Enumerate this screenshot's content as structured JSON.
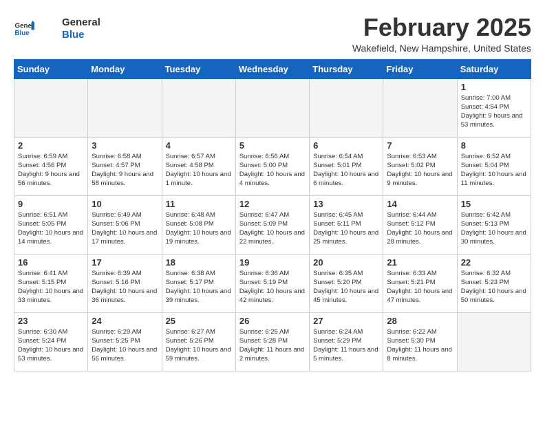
{
  "header": {
    "logo_line1": "General",
    "logo_line2": "Blue",
    "month_title": "February 2025",
    "location": "Wakefield, New Hampshire, United States"
  },
  "days_of_week": [
    "Sunday",
    "Monday",
    "Tuesday",
    "Wednesday",
    "Thursday",
    "Friday",
    "Saturday"
  ],
  "weeks": [
    [
      {
        "day": "",
        "info": ""
      },
      {
        "day": "",
        "info": ""
      },
      {
        "day": "",
        "info": ""
      },
      {
        "day": "",
        "info": ""
      },
      {
        "day": "",
        "info": ""
      },
      {
        "day": "",
        "info": ""
      },
      {
        "day": "1",
        "info": "Sunrise: 7:00 AM\nSunset: 4:54 PM\nDaylight: 9 hours\nand 53 minutes."
      }
    ],
    [
      {
        "day": "2",
        "info": "Sunrise: 6:59 AM\nSunset: 4:56 PM\nDaylight: 9 hours\nand 56 minutes."
      },
      {
        "day": "3",
        "info": "Sunrise: 6:58 AM\nSunset: 4:57 PM\nDaylight: 9 hours\nand 58 minutes."
      },
      {
        "day": "4",
        "info": "Sunrise: 6:57 AM\nSunset: 4:58 PM\nDaylight: 10 hours\nand 1 minute."
      },
      {
        "day": "5",
        "info": "Sunrise: 6:56 AM\nSunset: 5:00 PM\nDaylight: 10 hours\nand 4 minutes."
      },
      {
        "day": "6",
        "info": "Sunrise: 6:54 AM\nSunset: 5:01 PM\nDaylight: 10 hours\nand 6 minutes."
      },
      {
        "day": "7",
        "info": "Sunrise: 6:53 AM\nSunset: 5:02 PM\nDaylight: 10 hours\nand 9 minutes."
      },
      {
        "day": "8",
        "info": "Sunrise: 6:52 AM\nSunset: 5:04 PM\nDaylight: 10 hours\nand 11 minutes."
      }
    ],
    [
      {
        "day": "9",
        "info": "Sunrise: 6:51 AM\nSunset: 5:05 PM\nDaylight: 10 hours\nand 14 minutes."
      },
      {
        "day": "10",
        "info": "Sunrise: 6:49 AM\nSunset: 5:06 PM\nDaylight: 10 hours\nand 17 minutes."
      },
      {
        "day": "11",
        "info": "Sunrise: 6:48 AM\nSunset: 5:08 PM\nDaylight: 10 hours\nand 19 minutes."
      },
      {
        "day": "12",
        "info": "Sunrise: 6:47 AM\nSunset: 5:09 PM\nDaylight: 10 hours\nand 22 minutes."
      },
      {
        "day": "13",
        "info": "Sunrise: 6:45 AM\nSunset: 5:11 PM\nDaylight: 10 hours\nand 25 minutes."
      },
      {
        "day": "14",
        "info": "Sunrise: 6:44 AM\nSunset: 5:12 PM\nDaylight: 10 hours\nand 28 minutes."
      },
      {
        "day": "15",
        "info": "Sunrise: 6:42 AM\nSunset: 5:13 PM\nDaylight: 10 hours\nand 30 minutes."
      }
    ],
    [
      {
        "day": "16",
        "info": "Sunrise: 6:41 AM\nSunset: 5:15 PM\nDaylight: 10 hours\nand 33 minutes."
      },
      {
        "day": "17",
        "info": "Sunrise: 6:39 AM\nSunset: 5:16 PM\nDaylight: 10 hours\nand 36 minutes."
      },
      {
        "day": "18",
        "info": "Sunrise: 6:38 AM\nSunset: 5:17 PM\nDaylight: 10 hours\nand 39 minutes."
      },
      {
        "day": "19",
        "info": "Sunrise: 6:36 AM\nSunset: 5:19 PM\nDaylight: 10 hours\nand 42 minutes."
      },
      {
        "day": "20",
        "info": "Sunrise: 6:35 AM\nSunset: 5:20 PM\nDaylight: 10 hours\nand 45 minutes."
      },
      {
        "day": "21",
        "info": "Sunrise: 6:33 AM\nSunset: 5:21 PM\nDaylight: 10 hours\nand 47 minutes."
      },
      {
        "day": "22",
        "info": "Sunrise: 6:32 AM\nSunset: 5:23 PM\nDaylight: 10 hours\nand 50 minutes."
      }
    ],
    [
      {
        "day": "23",
        "info": "Sunrise: 6:30 AM\nSunset: 5:24 PM\nDaylight: 10 hours\nand 53 minutes."
      },
      {
        "day": "24",
        "info": "Sunrise: 6:29 AM\nSunset: 5:25 PM\nDaylight: 10 hours\nand 56 minutes."
      },
      {
        "day": "25",
        "info": "Sunrise: 6:27 AM\nSunset: 5:26 PM\nDaylight: 10 hours\nand 59 minutes."
      },
      {
        "day": "26",
        "info": "Sunrise: 6:25 AM\nSunset: 5:28 PM\nDaylight: 11 hours\nand 2 minutes."
      },
      {
        "day": "27",
        "info": "Sunrise: 6:24 AM\nSunset: 5:29 PM\nDaylight: 11 hours\nand 5 minutes."
      },
      {
        "day": "28",
        "info": "Sunrise: 6:22 AM\nSunset: 5:30 PM\nDaylight: 11 hours\nand 8 minutes."
      },
      {
        "day": "",
        "info": ""
      }
    ]
  ]
}
